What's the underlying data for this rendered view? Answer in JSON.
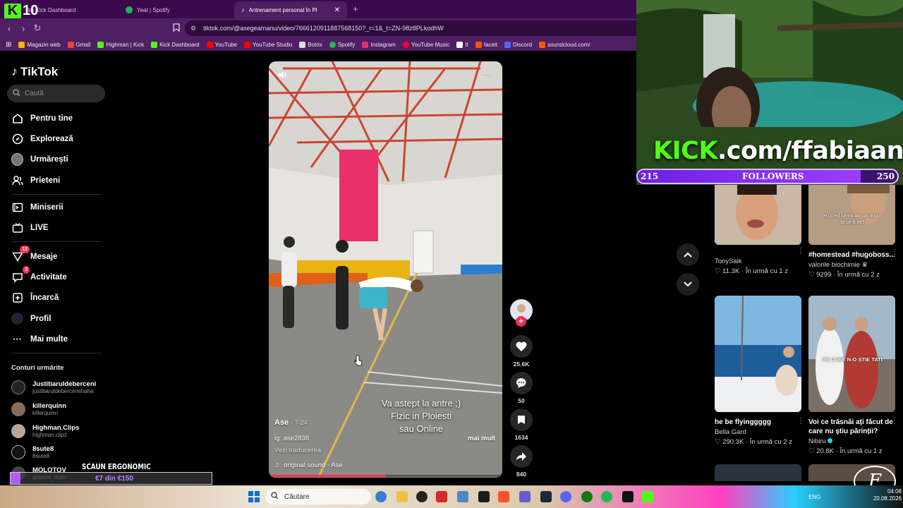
{
  "browser": {
    "tabs": [
      {
        "label": "ke Kick Dashboard",
        "active": false
      },
      {
        "label": "Yeat | Spotify",
        "active": false
      },
      {
        "label": "Antrenament personal în Ploi",
        "active": true
      }
    ],
    "url": "tiktok.com/@asegeamanu/video/7666120911887568150?_r=1&_t=ZN-98z8PLkodhW",
    "bookmarks": [
      {
        "label": "Magazin web",
        "color": "#ffb300"
      },
      {
        "label": "Gmail",
        "color": "#ea4335"
      },
      {
        "label": "Highman | Kick",
        "color": "#53fc18"
      },
      {
        "label": "Kick Dashboard",
        "color": "#53fc18"
      },
      {
        "label": "YouTube",
        "color": "#ff0000"
      },
      {
        "label": "YouTube Studio",
        "color": "#ff0000"
      },
      {
        "label": "Botrix",
        "color": "#dddddd"
      },
      {
        "label": "Spotify",
        "color": "#1db954"
      },
      {
        "label": "Instagram",
        "color": "#e1306c"
      },
      {
        "label": "YouTube Music",
        "color": "#ff0033"
      },
      {
        "label": "tt",
        "color": "#ffffff"
      },
      {
        "label": "faceit",
        "color": "#ff5500"
      },
      {
        "label": "Discord",
        "color": "#5865f2"
      },
      {
        "label": "soundcloud.com/",
        "color": "#ff5500"
      }
    ]
  },
  "stream": {
    "kick_number": "10",
    "kick_url_prefix": "KICK",
    "kick_url_suffix": ".com/ffabiaan",
    "followers_current": "215",
    "followers_label": "FOLLOWERS",
    "followers_goal": "250",
    "followers_fraction": 0.86,
    "ergo_title": "SCAUN ERGONOMIC",
    "ergo_progress": "€7 din €150",
    "ergo_fraction": 0.05
  },
  "sidebar": {
    "logo": "TikTok",
    "search_placeholder": "Caută",
    "nav": [
      {
        "label": "Pentru tine",
        "icon": "home-icon"
      },
      {
        "label": "Explorează",
        "icon": "compass-icon"
      },
      {
        "label": "Urmărești",
        "icon": "following-avatar-icon"
      },
      {
        "label": "Prieteni",
        "icon": "friends-icon"
      },
      {
        "label": "Miniserii",
        "icon": "miniseries-icon"
      },
      {
        "label": "LIVE",
        "icon": "live-icon"
      },
      {
        "label": "Mesaje",
        "icon": "messages-icon",
        "badge": "12"
      },
      {
        "label": "Activitate",
        "icon": "activity-icon",
        "badge": "2"
      },
      {
        "label": "Încarcă",
        "icon": "upload-icon"
      },
      {
        "label": "Profil",
        "icon": "profile-icon"
      },
      {
        "label": "Mai multe",
        "icon": "more-icon"
      }
    ],
    "following_title": "Conturi urmărite",
    "following": [
      {
        "name": "Justitiaruldeberceni",
        "handle": "justitiaruldeberceniihaha"
      },
      {
        "name": "killerquinn",
        "handle": "killerquinn"
      },
      {
        "name": "Highman.Clips",
        "handle": "highman.clipz"
      },
      {
        "name": "8sute8",
        "handle": "8sute8"
      },
      {
        "name": "MOLOTOV",
        "handle": "artwork_molo"
      }
    ]
  },
  "video": {
    "author": "Ase",
    "date": "7-24",
    "bio_line": "ig: ase2838",
    "translate": "Vezi traducerea",
    "more": "mai mult",
    "sound": "original sound - Ase",
    "caption_lines": [
      "Va astept la antre ;)",
      "Fizic in Ploiesti",
      "sau Online"
    ],
    "progress_fraction": 0.5,
    "likes": "25.6K",
    "comments": "50",
    "saves": "1634",
    "shares": "840"
  },
  "related": [
    {
      "title": "",
      "author": "TonySaik",
      "likes": "11.3K",
      "when": "În urmă cu 1 z",
      "thumb_text": ""
    },
    {
      "title": "#homestead #hugoboss...",
      "author": "valorile biochimie ♛",
      "likes": "9299",
      "when": "În urmă cu 2 z",
      "thumb_text": "eu cred că-mi iau un hugo, tu ce-ți iei?"
    },
    {
      "title": "he be flyinggggg",
      "author": "Bella Gard",
      "likes": "290.3K",
      "when": "În urmă cu 2 z",
      "thumb_text": ""
    },
    {
      "title": "Voi ce trăsnăi ați făcut de care nu știu părinții?",
      "author": "Nibiru",
      "likes": "20.8K",
      "when": "În urmă cu 1 z",
      "thumb_text": "PE CARE N-O ȘTIE TATI"
    }
  ],
  "taskbar": {
    "search_label": "Căutare",
    "lang": "ENG",
    "time": "04:08",
    "date": "20.08.2026"
  }
}
